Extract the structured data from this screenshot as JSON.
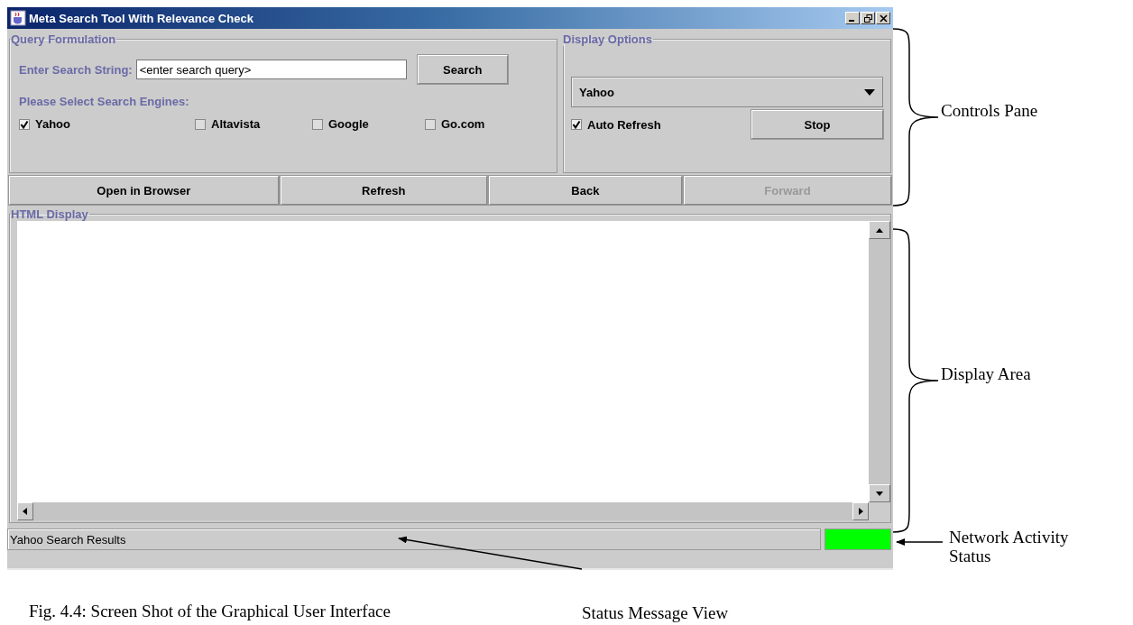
{
  "window": {
    "title": "Meta Search Tool With Relevance Check"
  },
  "query_formulation": {
    "legend": "Query Formulation",
    "search_label": "Enter Search String:",
    "search_value": "<enter search query>",
    "search_button": "Search",
    "engines_label": "Please Select Search Engines:",
    "engines": [
      {
        "label": "Yahoo",
        "checked": true
      },
      {
        "label": "Altavista",
        "checked": false
      },
      {
        "label": "Google",
        "checked": false
      },
      {
        "label": "Go.com",
        "checked": false
      }
    ]
  },
  "display_options": {
    "legend": "Display Options",
    "engine_dropdown": "Yahoo",
    "auto_refresh": {
      "label": "Auto Refresh",
      "checked": true
    },
    "stop_button": "Stop"
  },
  "nav_buttons": [
    {
      "label": "Open in Browser",
      "disabled": false
    },
    {
      "label": "Refresh",
      "disabled": false
    },
    {
      "label": "Back",
      "disabled": false
    },
    {
      "label": "Forward",
      "disabled": true
    }
  ],
  "html_display": {
    "legend": "HTML Display"
  },
  "status_bar": {
    "message": "Yahoo Search Results",
    "network_active": true
  },
  "annotations": [
    {
      "kind": "brace",
      "label": "Controls Pane"
    },
    {
      "kind": "brace",
      "label": "Display Area"
    },
    {
      "kind": "arrow",
      "label": "Network Activity Status"
    },
    {
      "kind": "arrow",
      "label": "Status Message View"
    }
  ],
  "caption": "Fig. 4.4: Screen Shot of the Graphical User Interface"
}
